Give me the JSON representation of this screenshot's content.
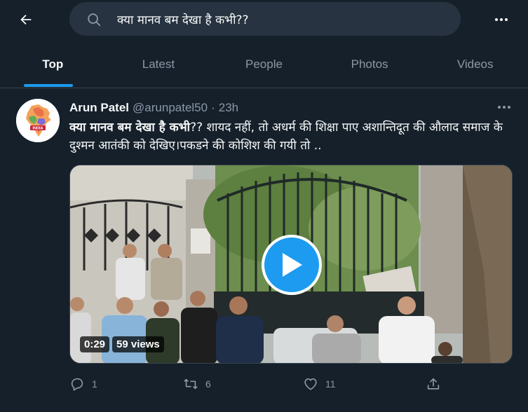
{
  "header": {
    "search_value": "क्या मानव बम देखा है कभी??",
    "icons": {
      "back": "arrow-left-icon",
      "search": "search-icon",
      "more": "more-dots-icon"
    }
  },
  "tabs": [
    {
      "label": "Top",
      "active": true
    },
    {
      "label": "Latest",
      "active": false
    },
    {
      "label": "People",
      "active": false
    },
    {
      "label": "Photos",
      "active": false
    },
    {
      "label": "Videos",
      "active": false
    }
  ],
  "tweet": {
    "author_name": "Arun Patel",
    "author_handle": "@arunpatel50",
    "separator": "·",
    "time": "23h",
    "avatar_label": "INDIA",
    "text_highlight": "क्या मानव बम देखा है कभी",
    "text_rest": "?? शायद नहीं, तो  अधर्म की शिक्षा पाए अशान्तिदूत की औलाद समाज के दुश्मन आतंकी को देखिए।पकडने की कोशिश की गयी तो ..",
    "video": {
      "duration": "0:29",
      "views": "59 views"
    },
    "actions": {
      "reply_count": "1",
      "retweet_count": "6",
      "like_count": "11"
    }
  },
  "colors": {
    "background": "#15202b",
    "accent": "#1d9bf0",
    "secondary_text": "#8b98a5",
    "search_bg": "#273340",
    "divider": "#38444d"
  }
}
